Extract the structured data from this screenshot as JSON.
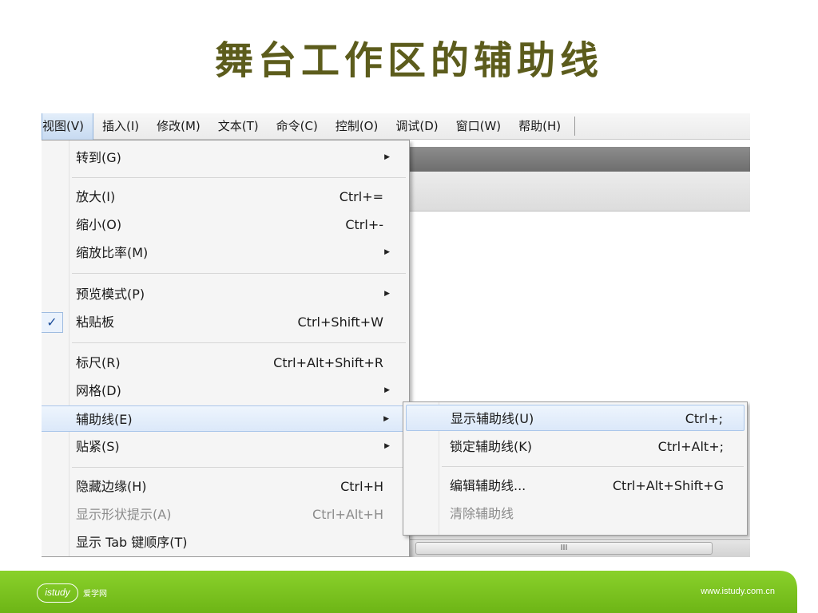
{
  "slide": {
    "title": "舞台工作区的辅助线"
  },
  "menubar": {
    "items": [
      "视图(V)",
      "插入(I)",
      "修改(M)",
      "文本(T)",
      "命令(C)",
      "控制(O)",
      "调试(D)",
      "窗口(W)",
      "帮助(H)"
    ],
    "active_index": 0
  },
  "view_menu": {
    "goto": {
      "label": "转到(G)"
    },
    "zoom_in": {
      "label": "放大(I)",
      "shortcut": "Ctrl+="
    },
    "zoom_out": {
      "label": "缩小(O)",
      "shortcut": "Ctrl+-"
    },
    "magnification": {
      "label": "缩放比率(M)"
    },
    "preview_mode": {
      "label": "预览模式(P)"
    },
    "pasteboard": {
      "label": "粘贴板",
      "shortcut": "Ctrl+Shift+W",
      "checked": true,
      "check_glyph": "✓"
    },
    "rulers": {
      "label": "标尺(R)",
      "shortcut": "Ctrl+Alt+Shift+R"
    },
    "grid": {
      "label": "网格(D)"
    },
    "guides": {
      "label": "辅助线(E)"
    },
    "snapping": {
      "label": "贴紧(S)"
    },
    "hide_edges": {
      "label": "隐藏边缘(H)",
      "shortcut": "Ctrl+H"
    },
    "show_shape_hints": {
      "label": "显示形状提示(A)",
      "shortcut": "Ctrl+Alt+H",
      "disabled": true
    },
    "show_tab_order": {
      "label": "显示 Tab 键顺序(T)"
    }
  },
  "guides_submenu": {
    "show_guides": {
      "label": "显示辅助线(U)",
      "shortcut": "Ctrl+;"
    },
    "lock_guides": {
      "label": "锁定辅助线(K)",
      "shortcut": "Ctrl+Alt+;"
    },
    "edit_guides": {
      "label": "编辑辅助线...",
      "shortcut": "Ctrl+Alt+Shift+G"
    },
    "clear_guides": {
      "label": "清除辅助线",
      "disabled": true
    }
  },
  "scrollbar": {
    "grip": "III"
  },
  "footer": {
    "logo_text": "istudy",
    "logo_cn": "爱学网",
    "site": "www.istudy.com.cn",
    "green": "#7cc51f"
  }
}
